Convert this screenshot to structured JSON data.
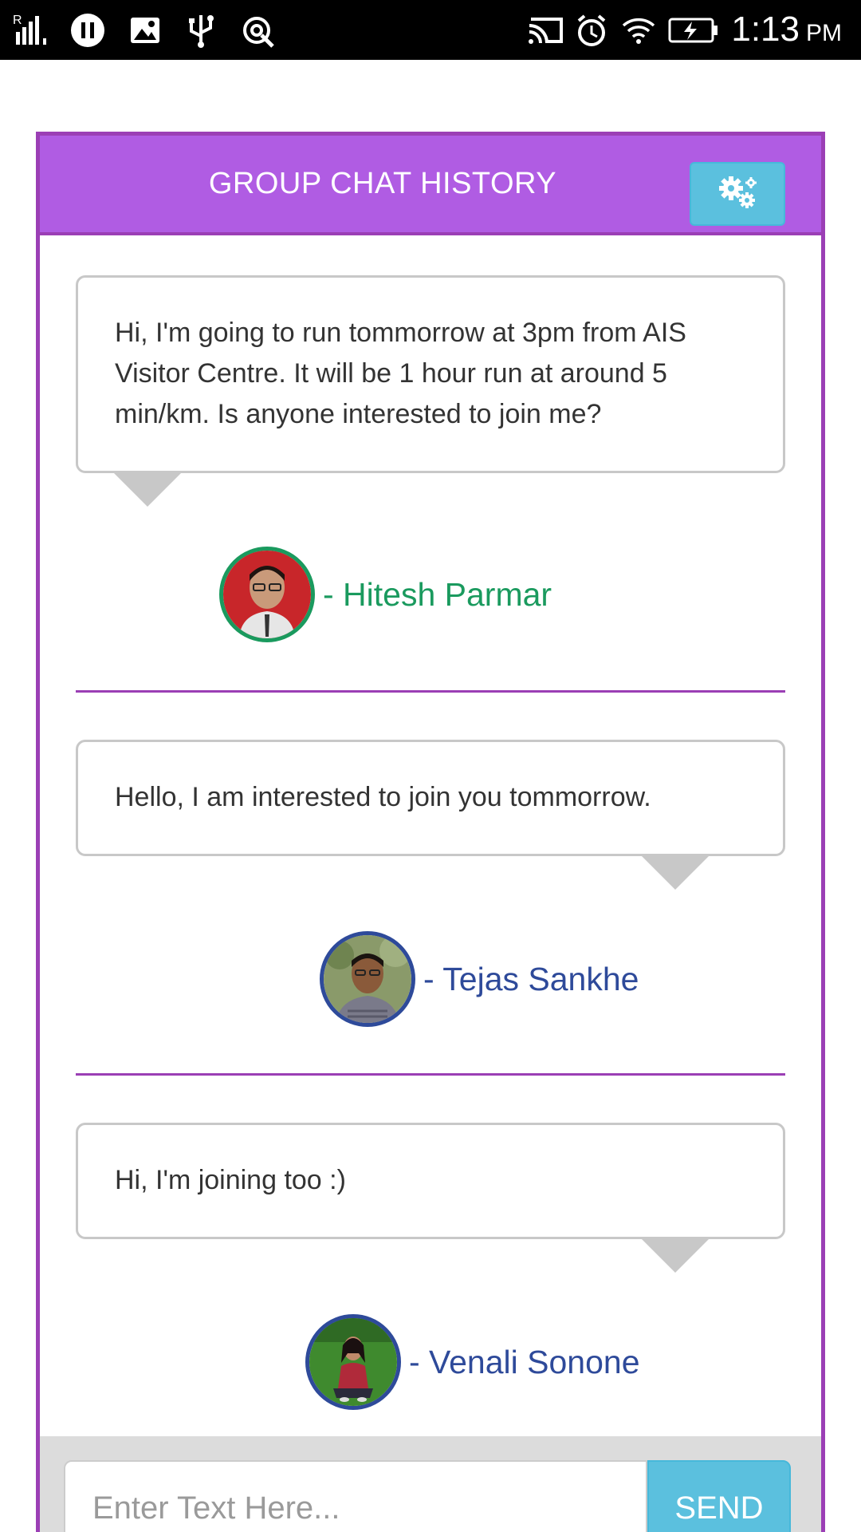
{
  "status_bar": {
    "time": "1:13",
    "ampm": "PM",
    "icons": [
      "signal-icon",
      "pause-icon",
      "image-icon",
      "usb-icon",
      "location-icon",
      "cast-icon",
      "alarm-icon",
      "wifi-icon",
      "battery-charging-icon"
    ]
  },
  "header": {
    "title": "GROUP CHAT HISTORY",
    "settings_icon": "gears-icon"
  },
  "messages": [
    {
      "text": "Hi, I'm going to run tommorrow at 3pm from AIS Visitor Centre. It will be 1 hour run at around 5 min/km. Is anyone interested to join me?",
      "author": "- Hitesh Parmar",
      "author_color": "#1a9a5e"
    },
    {
      "text": "Hello, I am interested to join you tommorrow.",
      "author": "- Tejas Sankhe",
      "author_color": "#2e4a9a"
    },
    {
      "text": "Hi, I'm joining too :)",
      "author": "- Venali Sonone",
      "author_color": "#2e4a9a"
    }
  ],
  "input": {
    "placeholder": "Enter Text Here...",
    "value": ""
  },
  "send_label": "SEND",
  "colors": {
    "header_bg": "#b05ce3",
    "border": "#9b3fb5",
    "button": "#5bc0de"
  }
}
